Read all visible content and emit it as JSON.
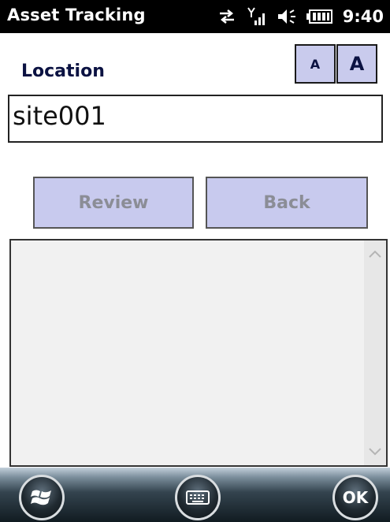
{
  "status_bar": {
    "app_title": "Asset Tracking",
    "time": "9:40",
    "icons": [
      "connectivity-icon",
      "signal-icon",
      "volume-icon",
      "battery-icon"
    ]
  },
  "header": {
    "location_label": "Location",
    "font_small_label": "A",
    "font_large_label": "A"
  },
  "location_input": {
    "value": "site001"
  },
  "buttons": {
    "review_label": "Review",
    "back_label": "Back"
  },
  "results_list": {
    "items": []
  },
  "softkeys": {
    "start_icon": "windows-start-icon",
    "keyboard_icon": "keyboard-icon",
    "ok_label": "OK"
  },
  "colors": {
    "status_bar_bg": "#000000",
    "button_bg": "#c8caee",
    "button_text_disabled": "#8b8d96",
    "label_text": "#0b1242"
  }
}
